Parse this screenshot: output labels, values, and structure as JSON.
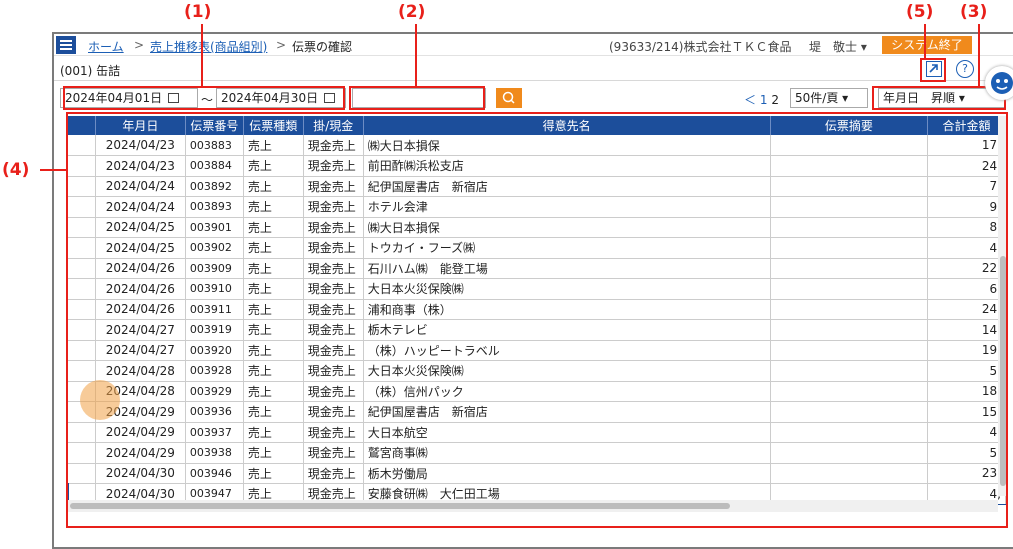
{
  "annotations": [
    "(1)",
    "(2)",
    "(5)",
    "(3)",
    "(4)"
  ],
  "breadcrumb": {
    "home": "ホーム",
    "sep1": ">",
    "sales": "売上推移表(商品組別)",
    "sep2": ">",
    "current": "伝票の確認"
  },
  "company": "(93633/214)株式会社ＴＫＣ食品",
  "user": "堤　敬士 ▾",
  "logout_label": "システム終了",
  "screen_name": "(001) 缶詰",
  "help_icon_text": "?",
  "filter": {
    "date_from": "2024年04月01日",
    "tilde": "～",
    "date_to": "2024年04月30日",
    "search_value": "",
    "page_prev": "＜",
    "page_1": "1",
    "page_2": "2",
    "per_page": "50件/頁 ▾",
    "sort": "年月日　昇順 ▾"
  },
  "table": {
    "headers": [
      "年月日",
      "伝票番号",
      "伝票種類",
      "掛/現金",
      "得意先名",
      "伝票摘要",
      "合計金額"
    ],
    "rows": [
      [
        "2024/04/23",
        "003883",
        "売上",
        "現金売上",
        "㈱大日本損保",
        "",
        "17,"
      ],
      [
        "2024/04/23",
        "003884",
        "売上",
        "現金売上",
        "前田酢㈱浜松支店",
        "",
        "24,"
      ],
      [
        "2024/04/24",
        "003892",
        "売上",
        "現金売上",
        "紀伊国屋書店　新宿店",
        "",
        "7,"
      ],
      [
        "2024/04/24",
        "003893",
        "売上",
        "現金売上",
        "ホテル会津",
        "",
        "9,"
      ],
      [
        "2024/04/25",
        "003901",
        "売上",
        "現金売上",
        "㈱大日本損保",
        "",
        "8,"
      ],
      [
        "2024/04/25",
        "003902",
        "売上",
        "現金売上",
        "トウカイ・フーズ㈱",
        "",
        "4,"
      ],
      [
        "2024/04/26",
        "003909",
        "売上",
        "現金売上",
        "石川ハム㈱　能登工場",
        "",
        "22,"
      ],
      [
        "2024/04/26",
        "003910",
        "売上",
        "現金売上",
        "大日本火災保険㈱",
        "",
        "6,"
      ],
      [
        "2024/04/26",
        "003911",
        "売上",
        "現金売上",
        "浦和商事（株）",
        "",
        "24,"
      ],
      [
        "2024/04/27",
        "003919",
        "売上",
        "現金売上",
        "栃木テレビ",
        "",
        "14,"
      ],
      [
        "2024/04/27",
        "003920",
        "売上",
        "現金売上",
        "（株）ハッピートラベル",
        "",
        "19,"
      ],
      [
        "2024/04/28",
        "003928",
        "売上",
        "現金売上",
        "大日本火災保険㈱",
        "",
        "5,"
      ],
      [
        "2024/04/28",
        "003929",
        "売上",
        "現金売上",
        "（株）信州パック",
        "",
        "18,"
      ],
      [
        "2024/04/29",
        "003936",
        "売上",
        "現金売上",
        "紀伊国屋書店　新宿店",
        "",
        "15,"
      ],
      [
        "2024/04/29",
        "003937",
        "売上",
        "現金売上",
        "大日本航空",
        "",
        "4,"
      ],
      [
        "2024/04/29",
        "003938",
        "売上",
        "現金売上",
        "鷲宮商事㈱",
        "",
        "5,"
      ],
      [
        "2024/04/30",
        "003946",
        "売上",
        "現金売上",
        "栃木労働局",
        "",
        "23,"
      ],
      [
        "2024/04/30",
        "003947",
        "売上",
        "現金売上",
        "安藤食研㈱　大仁田工場",
        "",
        "4,"
      ]
    ]
  },
  "colors": {
    "header_blue": "#1c4e9b",
    "accent_orange": "#f08a1c",
    "annotation_red": "#e8201a"
  }
}
